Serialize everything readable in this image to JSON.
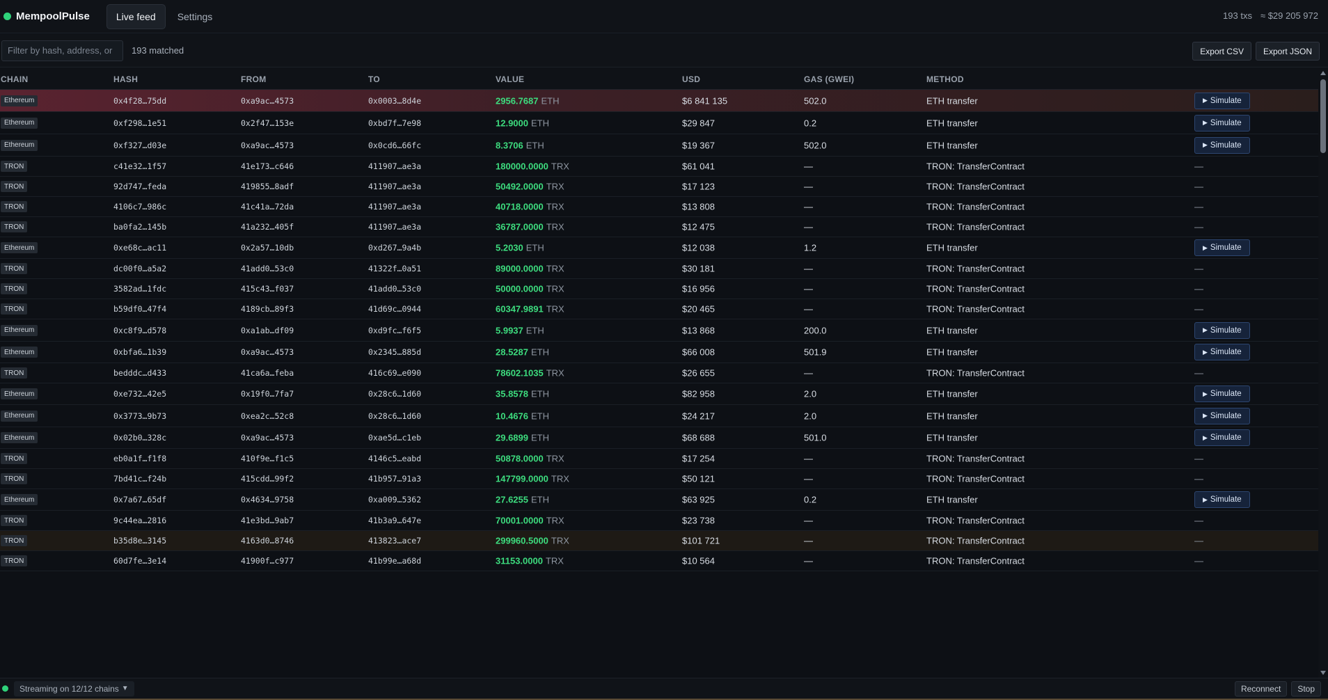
{
  "app": {
    "name": "MempoolPulse"
  },
  "nav": {
    "tabs": [
      {
        "label": "Live feed"
      },
      {
        "label": "Settings"
      }
    ]
  },
  "stats": {
    "tx_count": "193 txs",
    "total_usd": "≈ $29 205 972"
  },
  "filter": {
    "placeholder": "Filter by hash, address, or",
    "value": "",
    "matched": "193 matched"
  },
  "export": {
    "csv_label": "Export CSV",
    "json_label": "Export JSON"
  },
  "columns": {
    "chain": "CHAIN",
    "hash": "HASH",
    "from": "FROM",
    "to": "TO",
    "value": "VALUE",
    "usd": "USD",
    "gas": "GAS (GWEI)",
    "method": "METHOD"
  },
  "simulate_label": "Simulate",
  "rows": [
    {
      "chain": "Ethereum",
      "hash": "0x4f28…75dd",
      "from": "0xa9ac…4573",
      "to": "0x0003…8d4e",
      "value": "2956.7687",
      "unit": "ETH",
      "usd": "$6 841 135",
      "gas": "502.0",
      "method": "ETH transfer",
      "action": "Simulate",
      "highlight": "red"
    },
    {
      "chain": "Ethereum",
      "hash": "0xf298…1e51",
      "from": "0x2f47…153e",
      "to": "0xbd7f…7e98",
      "value": "12.9000",
      "unit": "ETH",
      "usd": "$29 847",
      "gas": "0.2",
      "method": "ETH transfer",
      "action": "Simulate"
    },
    {
      "chain": "Ethereum",
      "hash": "0xf327…d03e",
      "from": "0xa9ac…4573",
      "to": "0x0cd6…66fc",
      "value": "8.3706",
      "unit": "ETH",
      "usd": "$19 367",
      "gas": "502.0",
      "method": "ETH transfer",
      "action": "Simulate"
    },
    {
      "chain": "TRON",
      "hash": "c41e32…1f57",
      "from": "41e173…c646",
      "to": "411907…ae3a",
      "value": "180000.0000",
      "unit": "TRX",
      "usd": "$61 041",
      "gas": "—",
      "method": "TRON: TransferContract",
      "action": "—"
    },
    {
      "chain": "TRON",
      "hash": "92d747…feda",
      "from": "419855…8adf",
      "to": "411907…ae3a",
      "value": "50492.0000",
      "unit": "TRX",
      "usd": "$17 123",
      "gas": "—",
      "method": "TRON: TransferContract",
      "action": "—"
    },
    {
      "chain": "TRON",
      "hash": "4106c7…986c",
      "from": "41c41a…72da",
      "to": "411907…ae3a",
      "value": "40718.0000",
      "unit": "TRX",
      "usd": "$13 808",
      "gas": "—",
      "method": "TRON: TransferContract",
      "action": "—"
    },
    {
      "chain": "TRON",
      "hash": "ba0fa2…145b",
      "from": "41a232…405f",
      "to": "411907…ae3a",
      "value": "36787.0000",
      "unit": "TRX",
      "usd": "$12 475",
      "gas": "—",
      "method": "TRON: TransferContract",
      "action": "—"
    },
    {
      "chain": "Ethereum",
      "hash": "0xe68c…ac11",
      "from": "0x2a57…10db",
      "to": "0xd267…9a4b",
      "value": "5.2030",
      "unit": "ETH",
      "usd": "$12 038",
      "gas": "1.2",
      "method": "ETH transfer",
      "action": "Simulate"
    },
    {
      "chain": "TRON",
      "hash": "dc00f0…a5a2",
      "from": "41add0…53c0",
      "to": "41322f…0a51",
      "value": "89000.0000",
      "unit": "TRX",
      "usd": "$30 181",
      "gas": "—",
      "method": "TRON: TransferContract",
      "action": "—"
    },
    {
      "chain": "TRON",
      "hash": "3582ad…1fdc",
      "from": "415c43…f037",
      "to": "41add0…53c0",
      "value": "50000.0000",
      "unit": "TRX",
      "usd": "$16 956",
      "gas": "—",
      "method": "TRON: TransferContract",
      "action": "—"
    },
    {
      "chain": "TRON",
      "hash": "b59df0…47f4",
      "from": "4189cb…89f3",
      "to": "41d69c…0944",
      "value": "60347.9891",
      "unit": "TRX",
      "usd": "$20 465",
      "gas": "—",
      "method": "TRON: TransferContract",
      "action": "—"
    },
    {
      "chain": "Ethereum",
      "hash": "0xc8f9…d578",
      "from": "0xa1ab…df09",
      "to": "0xd9fc…f6f5",
      "value": "5.9937",
      "unit": "ETH",
      "usd": "$13 868",
      "gas": "200.0",
      "method": "ETH transfer",
      "action": "Simulate"
    },
    {
      "chain": "Ethereum",
      "hash": "0xbfa6…1b39",
      "from": "0xa9ac…4573",
      "to": "0x2345…885d",
      "value": "28.5287",
      "unit": "ETH",
      "usd": "$66 008",
      "gas": "501.9",
      "method": "ETH transfer",
      "action": "Simulate"
    },
    {
      "chain": "TRON",
      "hash": "bedddc…d433",
      "from": "41ca6a…feba",
      "to": "416c69…e090",
      "value": "78602.1035",
      "unit": "TRX",
      "usd": "$26 655",
      "gas": "—",
      "method": "TRON: TransferContract",
      "action": "—"
    },
    {
      "chain": "Ethereum",
      "hash": "0xe732…42e5",
      "from": "0x19f0…7fa7",
      "to": "0x28c6…1d60",
      "value": "35.8578",
      "unit": "ETH",
      "usd": "$82 958",
      "gas": "2.0",
      "method": "ETH transfer",
      "action": "Simulate"
    },
    {
      "chain": "Ethereum",
      "hash": "0x3773…9b73",
      "from": "0xea2c…52c8",
      "to": "0x28c6…1d60",
      "value": "10.4676",
      "unit": "ETH",
      "usd": "$24 217",
      "gas": "2.0",
      "method": "ETH transfer",
      "action": "Simulate"
    },
    {
      "chain": "Ethereum",
      "hash": "0x02b0…328c",
      "from": "0xa9ac…4573",
      "to": "0xae5d…c1eb",
      "value": "29.6899",
      "unit": "ETH",
      "usd": "$68 688",
      "gas": "501.0",
      "method": "ETH transfer",
      "action": "Simulate"
    },
    {
      "chain": "TRON",
      "hash": "eb0a1f…f1f8",
      "from": "410f9e…f1c5",
      "to": "4146c5…eabd",
      "value": "50878.0000",
      "unit": "TRX",
      "usd": "$17 254",
      "gas": "—",
      "method": "TRON: TransferContract",
      "action": "—"
    },
    {
      "chain": "TRON",
      "hash": "7bd41c…f24b",
      "from": "415cdd…99f2",
      "to": "41b957…91a3",
      "value": "147799.0000",
      "unit": "TRX",
      "usd": "$50 121",
      "gas": "—",
      "method": "TRON: TransferContract",
      "action": "—"
    },
    {
      "chain": "Ethereum",
      "hash": "0x7a67…65df",
      "from": "0x4634…9758",
      "to": "0xa009…5362",
      "value": "27.6255",
      "unit": "ETH",
      "usd": "$63 925",
      "gas": "0.2",
      "method": "ETH transfer",
      "action": "Simulate"
    },
    {
      "chain": "TRON",
      "hash": "9c44ea…2816",
      "from": "41e3bd…9ab7",
      "to": "41b3a9…647e",
      "value": "70001.0000",
      "unit": "TRX",
      "usd": "$23 738",
      "gas": "—",
      "method": "TRON: TransferContract",
      "action": "—"
    },
    {
      "chain": "TRON",
      "hash": "b35d8e…3145",
      "from": "4163d0…8746",
      "to": "413823…ace7",
      "value": "299960.5000",
      "unit": "TRX",
      "usd": "$101 721",
      "gas": "—",
      "method": "TRON: TransferContract",
      "action": "—",
      "highlight": "amber"
    },
    {
      "chain": "TRON",
      "hash": "60d7fe…3e14",
      "from": "41900f…c977",
      "to": "41b99e…a68d",
      "value": "31153.0000",
      "unit": "TRX",
      "usd": "$10 564",
      "gas": "—",
      "method": "TRON: TransferContract",
      "action": "—"
    }
  ],
  "footer": {
    "status": "Streaming on 12/12 chains",
    "reconnect_label": "Reconnect",
    "stop_label": "Stop"
  },
  "colors": {
    "accent_green": "#3ddc7e",
    "live_dot": "#2fd27a",
    "highlight_red": "#5a2330",
    "highlight_amber": "#1e1a15",
    "simulate_border": "#2d4670"
  }
}
